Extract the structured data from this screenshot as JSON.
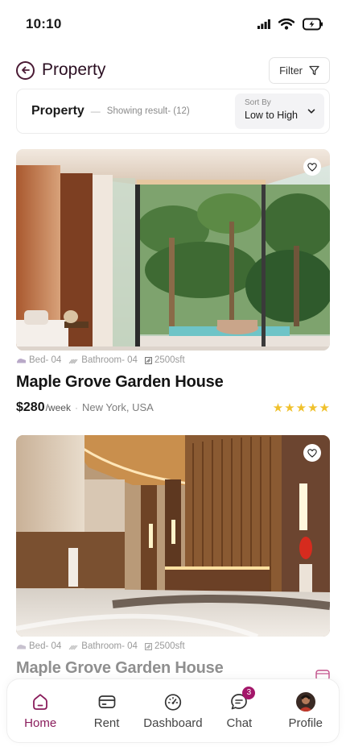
{
  "status_bar": {
    "time": "10:10"
  },
  "header": {
    "title": "Property",
    "filter_label": "Filter"
  },
  "sort_bar": {
    "section_title": "Property",
    "dash": "—",
    "result_text": "Showing result- (12)",
    "sort_label": "Sort By",
    "sort_value": "Low to High"
  },
  "properties": [
    {
      "bed": "Bed- 04",
      "bath": "Bathroom- 04",
      "area": "2500sft",
      "title": "Maple Grove Garden House",
      "price": "$280",
      "period": "/week",
      "separator": "·",
      "location": "New York, USA",
      "rating": 5
    },
    {
      "bed": "Bed- 04",
      "bath": "Bathroom- 04",
      "area": "2500sft",
      "title": "Maple Grove Garden House"
    }
  ],
  "nav": {
    "items": [
      {
        "label": "Home",
        "icon": "home-icon",
        "active": true
      },
      {
        "label": "Rent",
        "icon": "card-icon"
      },
      {
        "label": "Dashboard",
        "icon": "gauge-icon"
      },
      {
        "label": "Chat",
        "icon": "chat-icon",
        "badge": "3"
      },
      {
        "label": "Profile",
        "icon": "avatar"
      }
    ]
  },
  "colors": {
    "accent": "#8a1d5c",
    "badge": "#a3176a",
    "star": "#f0c12c"
  }
}
